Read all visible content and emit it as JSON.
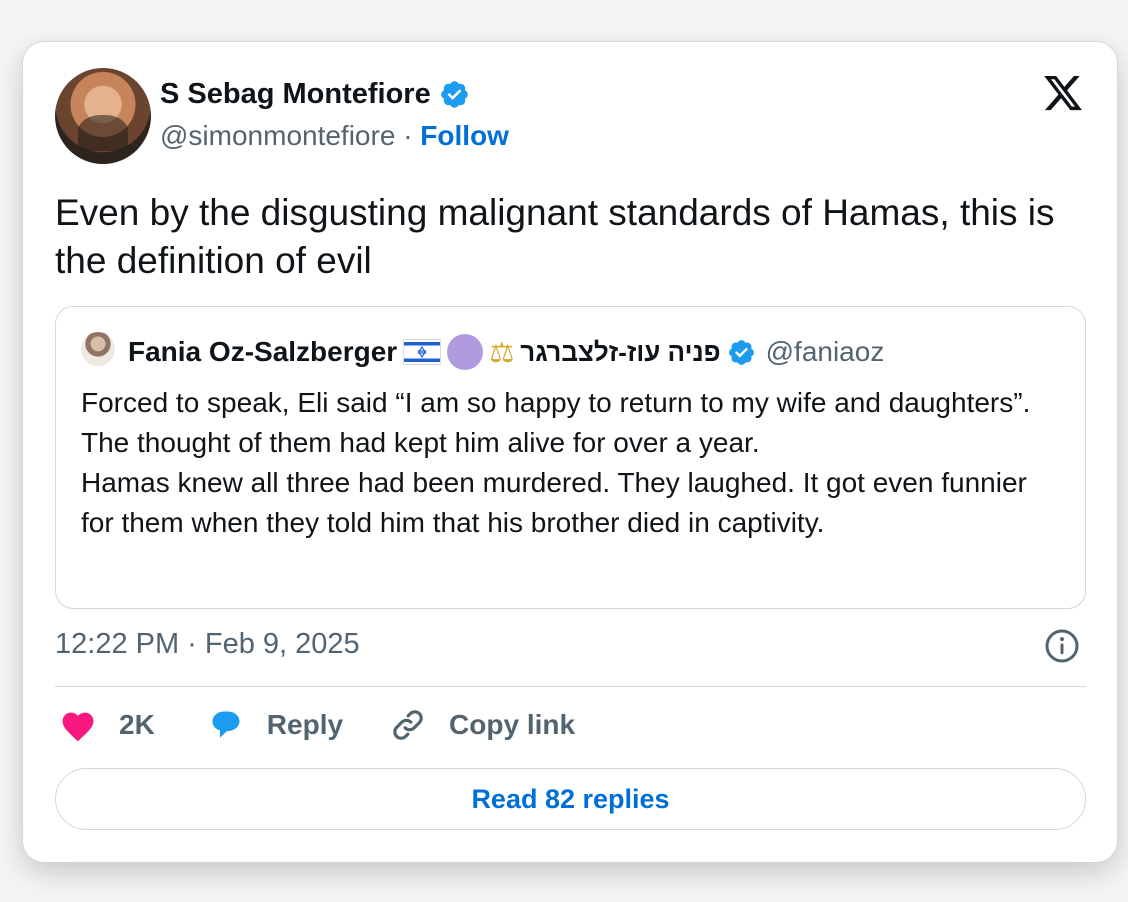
{
  "author": {
    "name": "S Sebag Montefiore",
    "handle": "@simonmontefiore",
    "separator": "·",
    "follow_label": "Follow"
  },
  "tweet": {
    "text": "Even by the disgusting malignant standards of Hamas, this is the definition of evil"
  },
  "quoted": {
    "name": "Fania Oz-Salzberger",
    "hebrew_name": "פניה עוז-זלצברגר",
    "handle": "@faniaoz",
    "body": "Forced to speak, Eli said “I am so happy to return to my wife and daughters”.\nThe thought of them had kept him alive for over a year.\nHamas knew all three had been murdered. They laughed. It got even funnier for them when they told him that his brother died in captivity."
  },
  "meta": {
    "timestamp": "12:22 PM · Feb 9, 2025"
  },
  "actions": {
    "like_count": "2K",
    "reply_label": "Reply",
    "copy_label": "Copy link"
  },
  "read_replies_label": "Read 82 replies",
  "colors": {
    "accent": "#006fd6",
    "verified": "#1d9bf0",
    "heart": "#f91880",
    "text": "#0f1419",
    "muted": "#536471"
  },
  "icons": [
    "verified-badge-icon",
    "x-logo-icon",
    "israel-flag-icon",
    "purple-circle-icon",
    "scales-icon",
    "info-icon",
    "heart-icon",
    "reply-bubble-icon",
    "link-icon"
  ]
}
